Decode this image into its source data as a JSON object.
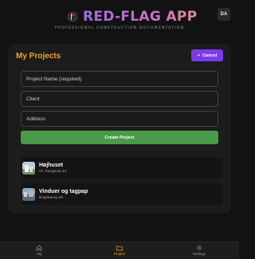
{
  "header": {
    "app_title": "RED-FLAG APP",
    "tagline": "PROFESSIONAL CONSTRUCTION DOCUMENTATION",
    "avatar_initials": "DA"
  },
  "projects_card": {
    "title": "My Projects",
    "cancel_label": "Cancel",
    "form": {
      "name_placeholder": "Project Name (required)",
      "client_placeholder": "Client",
      "address_placeholder": "Address",
      "create_label": "Create Project"
    },
    "projects": [
      {
        "name": "Højhuset",
        "address": "Gl. Kongevej 44"
      },
      {
        "name": "Vinduer og tagpap",
        "address": "Bogstavvej 66"
      }
    ]
  },
  "bottom_nav": {
    "items": [
      {
        "label": "HQ",
        "icon": "home-icon"
      },
      {
        "label": "Project",
        "icon": "folder-icon",
        "active": true
      },
      {
        "label": "Settings",
        "icon": "gear-icon"
      }
    ]
  },
  "colors": {
    "accent": "#f0a329",
    "purple": "#7c3aed",
    "green": "#4a9b49",
    "background": "#121212"
  }
}
